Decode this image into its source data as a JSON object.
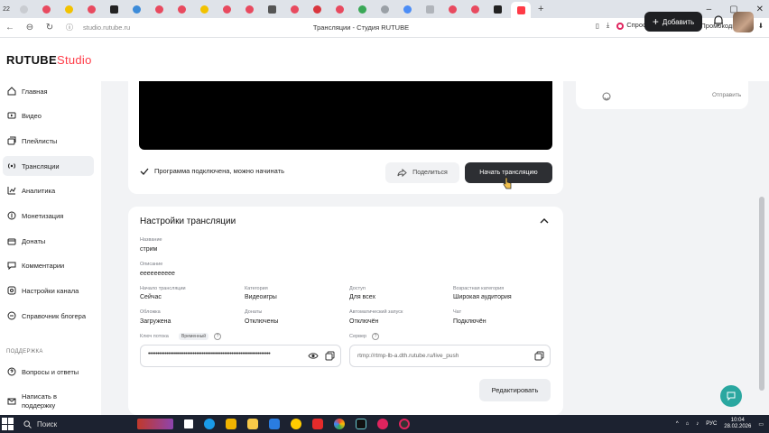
{
  "browser": {
    "tab_count": "22",
    "page_title": "Трансляции - Студия RUTUBE",
    "url": "studio.rutube.ru",
    "ask_alice": "Спросить Алису AI",
    "promo": "Промокоды"
  },
  "header": {
    "logo_main": "RUTUBE",
    "logo_studio": "Studio",
    "add_button": "Добавить"
  },
  "sidebar": {
    "items": [
      {
        "label": "Главная",
        "icon": "home-icon"
      },
      {
        "label": "Видео",
        "icon": "video-icon"
      },
      {
        "label": "Плейлисты",
        "icon": "playlist-icon"
      },
      {
        "label": "Трансляции",
        "icon": "broadcast-icon",
        "active": true
      },
      {
        "label": "Аналитика",
        "icon": "analytics-icon"
      },
      {
        "label": "Монетизация",
        "icon": "money-icon"
      },
      {
        "label": "Донаты",
        "icon": "donate-icon"
      },
      {
        "label": "Комментарии",
        "icon": "comments-icon"
      },
      {
        "label": "Настройки канала",
        "icon": "settings-icon"
      },
      {
        "label": "Справочник блогера",
        "icon": "book-icon"
      }
    ],
    "support_section": "ПОДДЕРЖКА",
    "support_items": [
      {
        "label": "Вопросы и ответы",
        "icon": "faq-icon"
      },
      {
        "label": "Написать в поддержку",
        "icon": "mail-icon"
      }
    ]
  },
  "stream": {
    "status_text": "Программа подключена, можно начинать",
    "share_button": "Поделиться",
    "start_button": "Начать трансляцию"
  },
  "chat": {
    "send_label": "Отправить"
  },
  "settings": {
    "title": "Настройки трансляции",
    "name_label": "Название",
    "name_value": "стрим",
    "description_label": "Описание",
    "description_value": "eeeeeeeeee",
    "start_label": "Начало трансляции",
    "start_value": "Сейчас",
    "category_label": "Категория",
    "category_value": "Видеоигры",
    "access_label": "Доступ",
    "access_value": "Для всех",
    "age_label": "Возрастная категория",
    "age_value": "Широкая аудитория",
    "cover_label": "Обложка",
    "cover_value": "Загружена",
    "donations_label": "Донаты",
    "donations_value": "Отключены",
    "autostart_label": "Автоматический запуск",
    "autostart_value": "Отключён",
    "chat_label": "Чат",
    "chat_value": "Подключён",
    "key_label": "Ключ потока",
    "key_badge": "Временный",
    "key_value": "••••••••••••••••••••••••••••••••••••••••••••••••••••••••••••••••••",
    "server_label": "Сервер",
    "server_value": "rtmp://rtmp-lb-a.dth.rutube.ru/live_push",
    "edit_button": "Редактировать"
  },
  "taskbar": {
    "search": "Поиск",
    "lang": "РУС",
    "time": "10:04",
    "date": "28.02.2026"
  },
  "colors": {
    "brand_red": "#ff3b47",
    "dark_button": "#2d2f33",
    "fab_teal": "#2aa7a0"
  }
}
